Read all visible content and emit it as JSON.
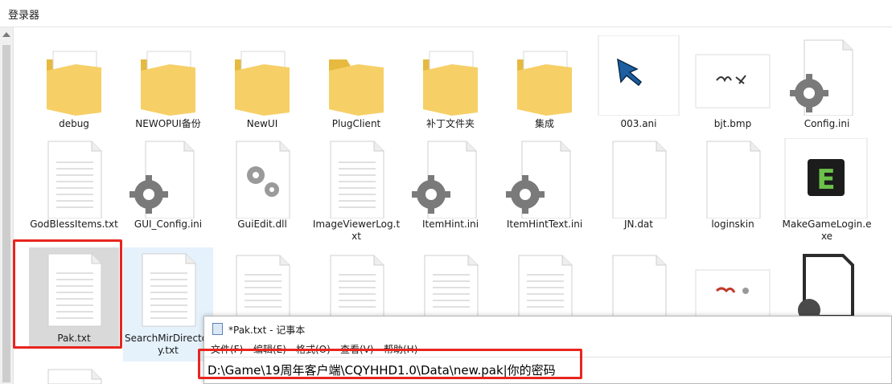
{
  "window": {
    "title": "登录器"
  },
  "items": [
    {
      "label": "debug",
      "icon": "folder-icon"
    },
    {
      "label": "NEWOPUI备份",
      "icon": "folder-icon"
    },
    {
      "label": "NewUI",
      "icon": "folder-icon"
    },
    {
      "label": "PlugClient",
      "icon": "folder-icon"
    },
    {
      "label": "补丁文件夹",
      "icon": "folder-icon"
    },
    {
      "label": "集成",
      "icon": "folder-icon"
    },
    {
      "label": "003.ani",
      "icon": "cursor-file-icon"
    },
    {
      "label": "bjt.bmp",
      "icon": "image-file-icon"
    },
    {
      "label": "Config.ini",
      "icon": "settings-file-icon"
    },
    {
      "label": "GodBlessItems.txt",
      "icon": "text-file-icon"
    },
    {
      "label": "GUI_Config.ini",
      "icon": "settings-file-icon"
    },
    {
      "label": "GuiEdit.dll",
      "icon": "dll-file-icon"
    },
    {
      "label": "ImageViewerLog.txt",
      "icon": "text-file-icon"
    },
    {
      "label": "ItemHint.ini",
      "icon": "settings-file-icon"
    },
    {
      "label": "ItemHintText.ini",
      "icon": "settings-file-icon"
    },
    {
      "label": "JN.dat",
      "icon": "blank-file-icon"
    },
    {
      "label": "loginskin",
      "icon": "blank-file-icon"
    },
    {
      "label": "MakeGameLogin.exe",
      "icon": "exe-file-icon"
    },
    {
      "label": "Pak.txt",
      "icon": "text-file-icon"
    },
    {
      "label": "SearchMirDirectory.txt",
      "icon": "text-file-icon"
    }
  ],
  "notepad": {
    "title": "*Pak.txt - 记事本",
    "menu": [
      "文件(F)",
      "编辑(E)",
      "格式(O)",
      "查看(V)",
      "帮助(H)"
    ],
    "content": "D:\\Game\\19周年客户端\\CQYHHD1.0\\Data\\new.pak|你的密码"
  },
  "colors": {
    "folder": "#f6cf66",
    "highlight_border": "#e8251e",
    "selected_grey": "#d9d9d9",
    "selected_blue": "#e5f1fb"
  }
}
